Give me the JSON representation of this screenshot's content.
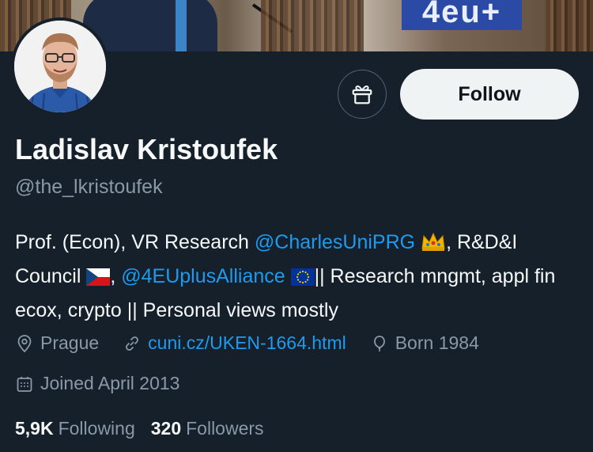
{
  "profile": {
    "name": "Ladislav Kristoufek",
    "handle": "@the_lkristoufek"
  },
  "actions": {
    "follow_label": "Follow",
    "gift_icon": "gift-icon"
  },
  "banner": {
    "sign_text": "4eu+"
  },
  "bio": {
    "part1": "Prof. (Econ), VR Research ",
    "mention1": "@CharlesUniPRG",
    "emoji1": "crown-emoji",
    "part2": ", R&D&I Council ",
    "emoji2": "czech-flag-emoji",
    "part3": ", ",
    "mention2": "@4EUplusAlliance",
    "emoji3": "eu-flag-emoji",
    "part4": "|| Research mngmt, appl fin ecox, crypto || Personal views mostly"
  },
  "meta": {
    "location": "Prague",
    "website": "cuni.cz/UKEN-1664.html",
    "born": "Born 1984",
    "joined": "Joined April 2013"
  },
  "stats": {
    "following_count": "5,9K",
    "following_label": "Following",
    "followers_count": "320",
    "followers_label": "Followers"
  },
  "colors": {
    "background": "#15202b",
    "link": "#1d9bf0",
    "secondary_text": "#8b98a5",
    "follow_button_bg": "#eff3f4"
  }
}
